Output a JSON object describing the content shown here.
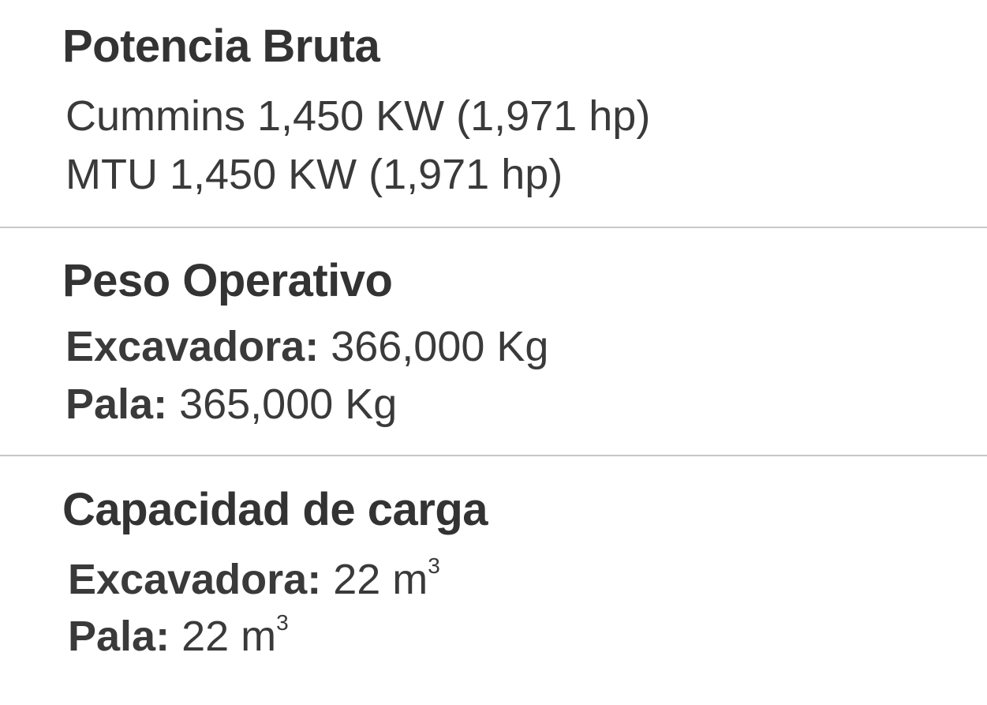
{
  "sections": [
    {
      "title": "Potencia Bruta",
      "lines": [
        {
          "label": "",
          "value": "Cummins 1,450 KW (1,971 hp)"
        },
        {
          "label": "",
          "value": "MTU 1,450 KW (1,971 hp)"
        }
      ]
    },
    {
      "title": "Peso Operativo",
      "lines": [
        {
          "label": "Excavadora:",
          "value": " 366,000 Kg"
        },
        {
          "label": "Pala:",
          "value": " 365,000 Kg"
        }
      ]
    },
    {
      "title": "Capacidad de carga",
      "lines": [
        {
          "label": "Excavadora:",
          "value": " 22 m",
          "sup": "3"
        },
        {
          "label": "Pala:",
          "value": " 22 m",
          "sup": "3"
        }
      ]
    }
  ]
}
